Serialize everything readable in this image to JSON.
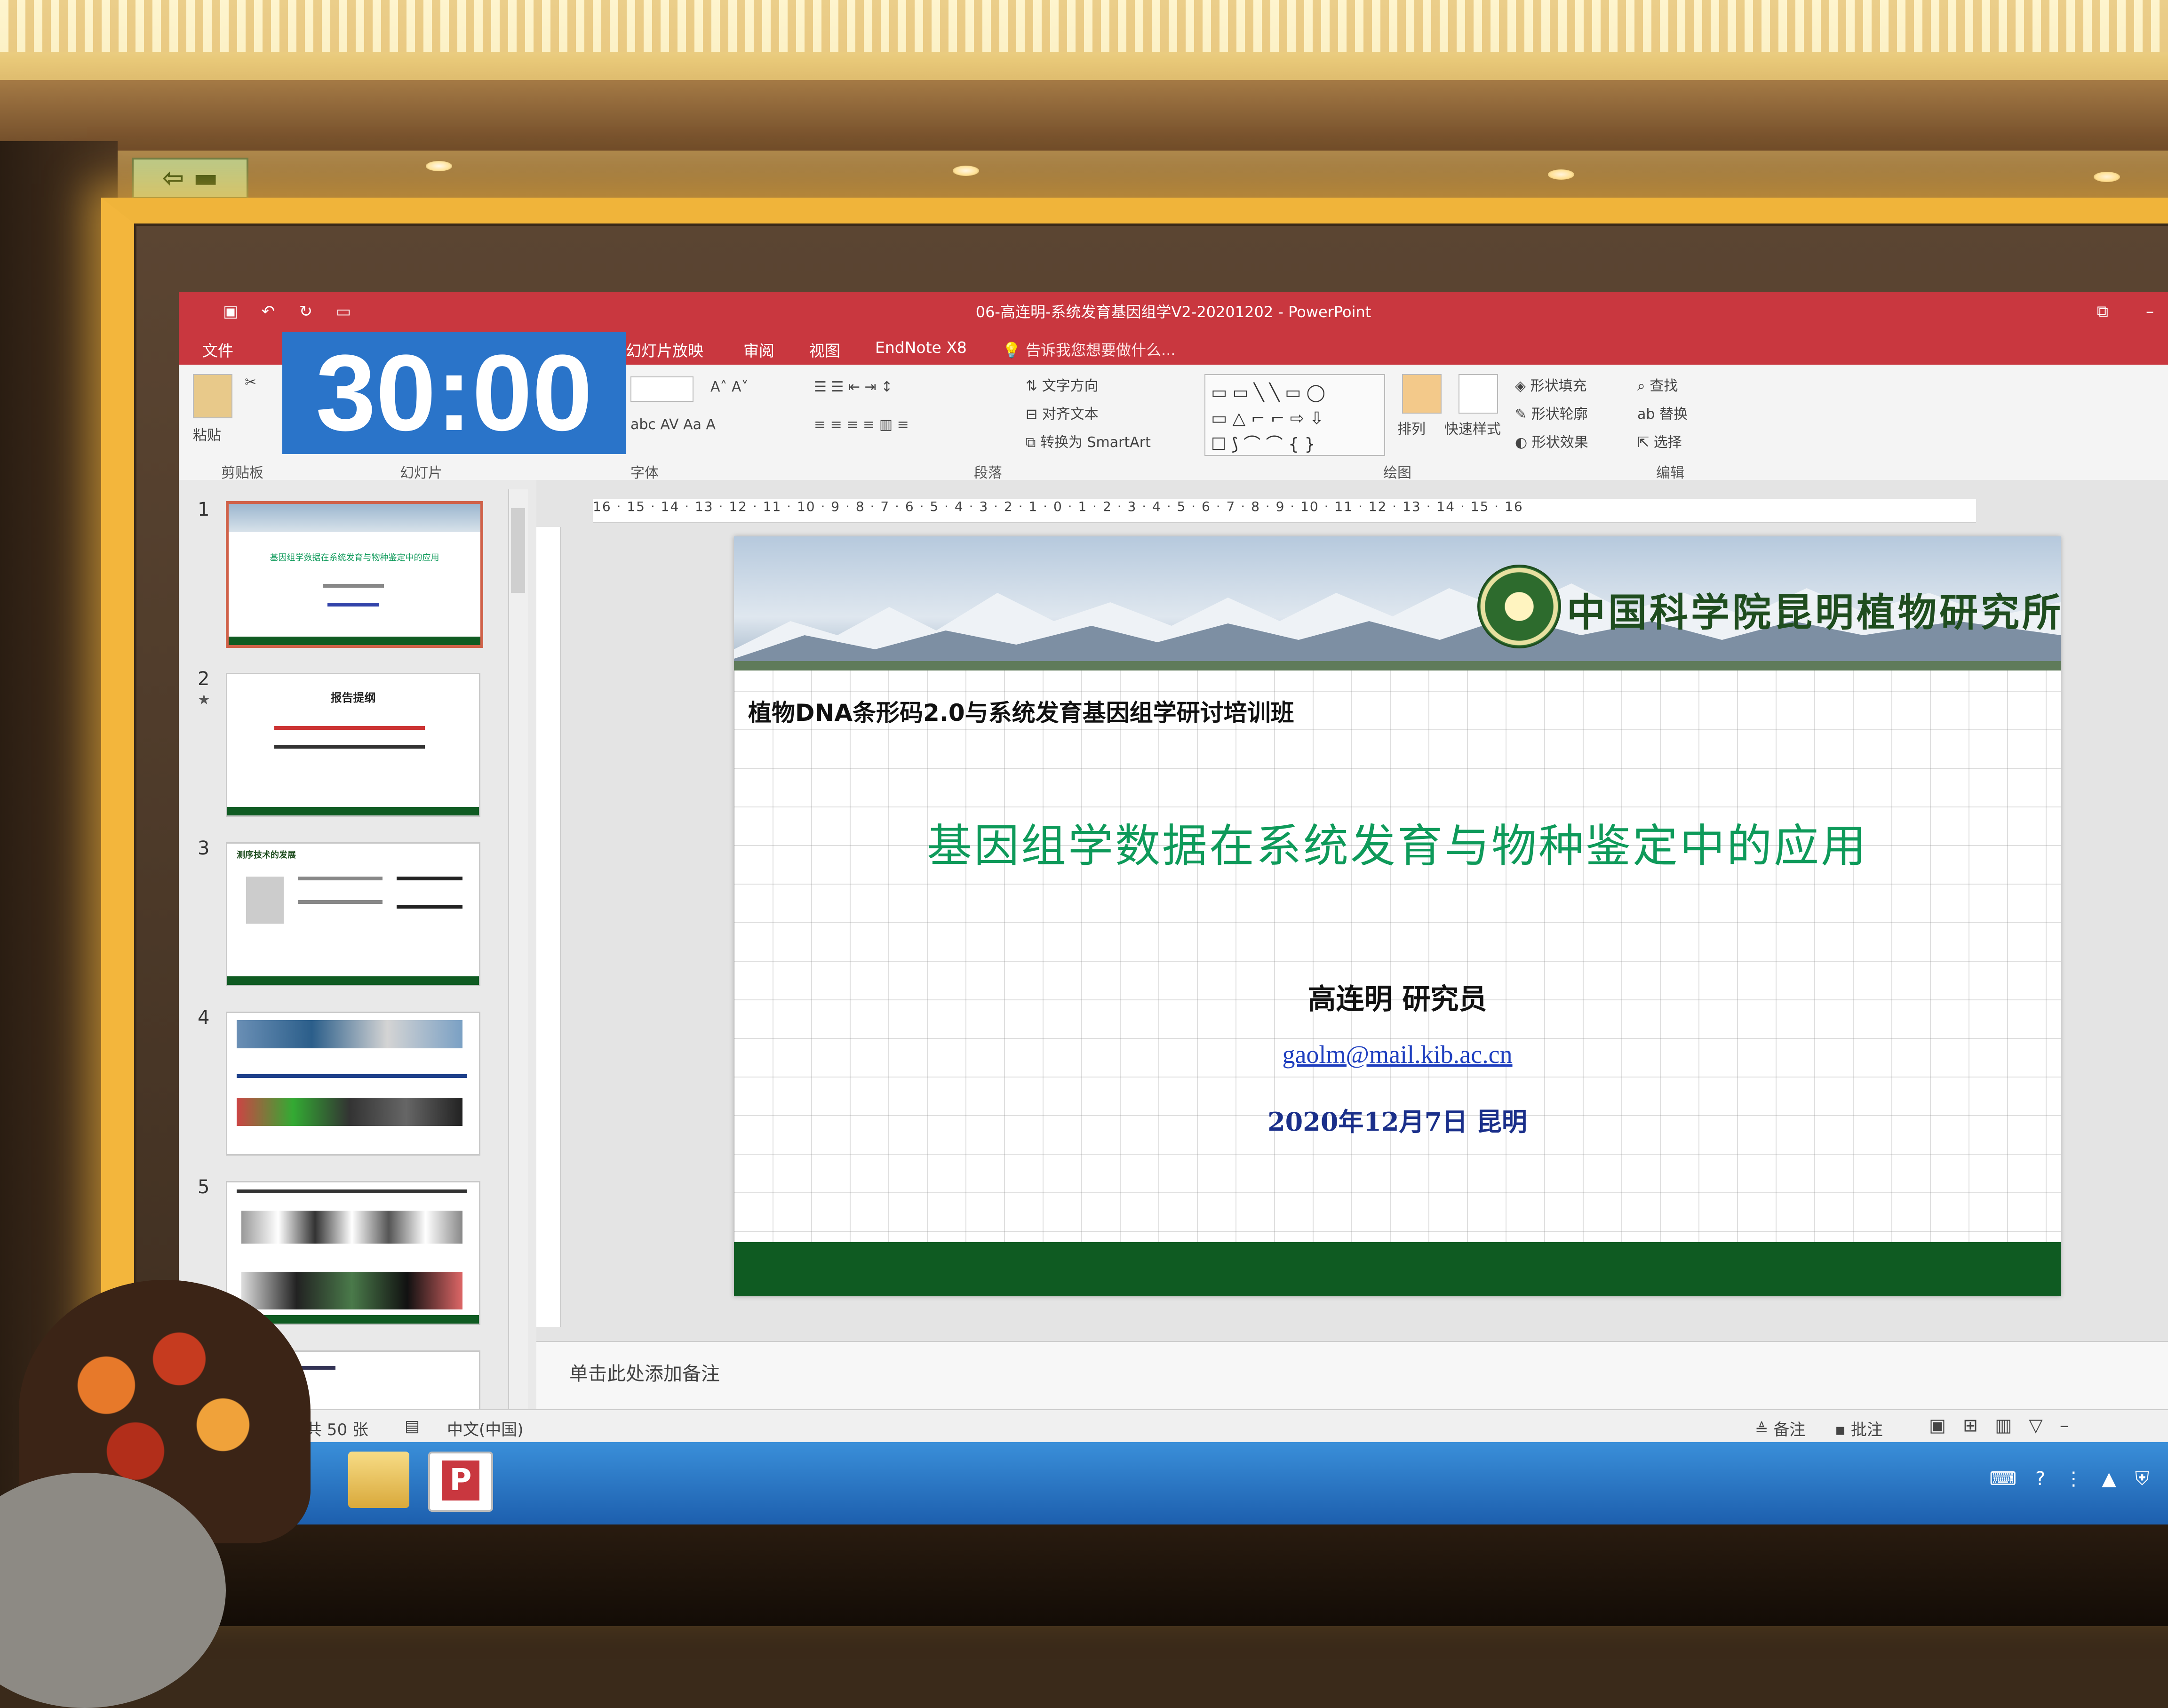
{
  "window": {
    "title": "06-高连明-系统发育基因组学V2-20201202 - PowerPoint"
  },
  "tabs": [
    "文件",
    "幻灯片放映",
    "审阅",
    "视图",
    "EndNote X8"
  ],
  "tell_me": "告诉我您想要做什么...",
  "timer": "30:00",
  "ribbon": {
    "paste": "粘贴",
    "groups": {
      "clipboard": "剪贴板",
      "slides": "幻灯片",
      "font": "字体",
      "paragraph": "段落",
      "drawing": "绘图",
      "editing": "编辑"
    },
    "text_direction": "文字方向",
    "align_text": "对齐文本",
    "smartart": "转换为 SmartArt",
    "arrange": "排列",
    "quick_styles": "快速样式",
    "shape_fill": "形状填充",
    "shape_outline": "形状轮廓",
    "shape_effects": "形状效果",
    "find": "查找",
    "replace": "替换",
    "select": "选择"
  },
  "thumbnails": [
    {
      "num": "1",
      "text": "基因组学数据在系统发育与物种鉴定中的应用"
    },
    {
      "num": "2",
      "text": "报告提纲"
    },
    {
      "num": "3",
      "text": "测序技术的发展"
    },
    {
      "num": "4",
      "text": ""
    },
    {
      "num": "5",
      "text": ""
    }
  ],
  "ruler_h": "16 · 15 · 14 · 13 · 12 · 11 · 10 · 9 · 8 · 7 · 6 · 5 · 4 · 3 · 2 · 1 · 0 · 1 · 2 · 3 · 4 · 5 · 6 · 7 · 8 · 9 · 10 · 11 · 12 · 13 · 14 · 15 · 16",
  "slide": {
    "logo_text": "中国科学院昆明植物研究所",
    "course": "植物DNA条形码2.0与系统发育基因组学研讨培训班",
    "title": "基因组学数据在系统发育与物种鉴定中的应用",
    "author": "高连明  研究员",
    "email": "gaolm@mail.kib.ac.cn",
    "date": "2020年12月7日  昆明"
  },
  "notes_placeholder": "单击此处添加备注",
  "status": {
    "slide_count": "共 50 张",
    "language": "中文(中国)",
    "notes": "备注",
    "comments": "批注"
  },
  "colors": {
    "titlebar": "#c9373f",
    "timer": "#2a74c9",
    "slide_title": "#0e9a5a",
    "footer_green": "#0f5b22"
  }
}
